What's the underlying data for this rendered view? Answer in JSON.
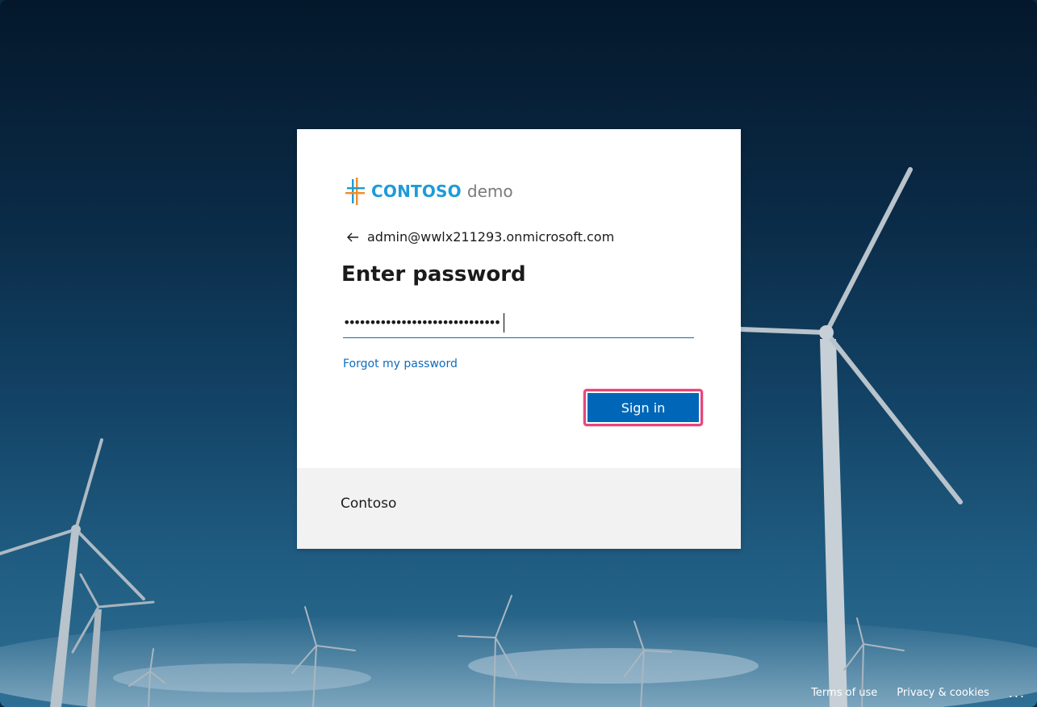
{
  "brand": {
    "name": "CONTOSO",
    "suffix": "demo",
    "colors": {
      "brand_blue": "#1e9bd7",
      "logo_orange": "#f28c28"
    }
  },
  "identity": {
    "email": "admin@wwlx211293.onmicrosoft.com"
  },
  "form": {
    "title": "Enter password",
    "password_masked": "••••••••••••••••••••••••••••••",
    "forgot_link": "Forgot my password",
    "submit_label": "Sign in"
  },
  "card_footer": {
    "org_name": "Contoso"
  },
  "page_footer": {
    "terms": "Terms of use",
    "privacy": "Privacy & cookies",
    "more": "..."
  },
  "colors": {
    "accent": "#0067b8",
    "link": "#0f6cbd",
    "highlight_ring": "#e8457a",
    "footer_bg": "#f2f2f2"
  }
}
